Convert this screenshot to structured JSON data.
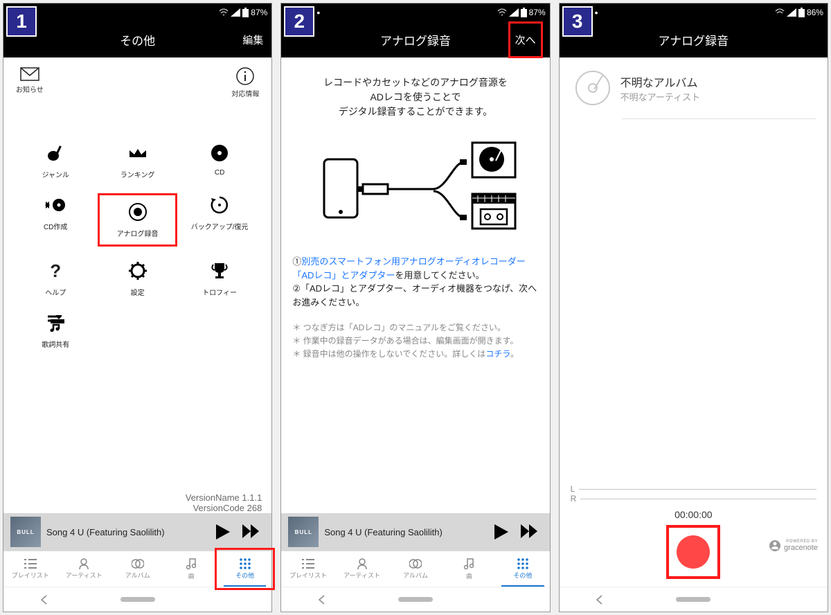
{
  "steps": [
    "1",
    "2",
    "3"
  ],
  "status": {
    "battery1": "87%",
    "battery3": "86%"
  },
  "s1": {
    "title": "その他",
    "edit": "編集",
    "notice": "お知らせ",
    "info": "対応情報",
    "grid": [
      {
        "label": "ジャンル"
      },
      {
        "label": "ランキング"
      },
      {
        "label": "CD"
      },
      {
        "label": "CD作成"
      },
      {
        "label": "アナログ録音"
      },
      {
        "label": "バックアップ/復元"
      },
      {
        "label": "ヘルプ"
      },
      {
        "label": "設定"
      },
      {
        "label": "トロフィー"
      },
      {
        "label": "歌詞共有"
      }
    ],
    "versionName": "VersionName 1.1.1",
    "versionCode": "VersionCode 268"
  },
  "s2": {
    "title": "アナログ録音",
    "next": "次へ",
    "desc1": "レコードやカセットなどのアナログ音源を",
    "desc2": "ADレコを使うことで",
    "desc3": "デジタル録音することができます。",
    "step1a": "①",
    "step1b": "別売のスマートフォン用アナログオーディオレコーダー「ADレコ」とアダプター",
    "step1c": "を用意してください。",
    "step2": "②「ADレコ」とアダプター、オーディオ機器をつなげ、次へお進みください。",
    "note1": "＊ つなぎ方は「ADレコ」のマニュアルをご覧ください。",
    "note2": "＊ 作業中の録音データがある場合は、編集画面が開きます。",
    "note3a": "＊ 録音中は他の操作をしないでください。詳しくは",
    "note3b": "コチラ",
    "note3c": "。"
  },
  "s3": {
    "title": "アナログ録音",
    "album": "不明なアルバム",
    "artist": "不明なアーティスト",
    "L": "L",
    "R": "R",
    "timer": "00:00:00",
    "powered": "POWERED BY",
    "gn": "gracenote"
  },
  "player": {
    "song": "Song 4 U (Featuring Saolilith)"
  },
  "tabs": [
    {
      "label": "プレイリスト"
    },
    {
      "label": "アーティスト"
    },
    {
      "label": "アルバム"
    },
    {
      "label": "曲"
    },
    {
      "label": "その他"
    }
  ]
}
